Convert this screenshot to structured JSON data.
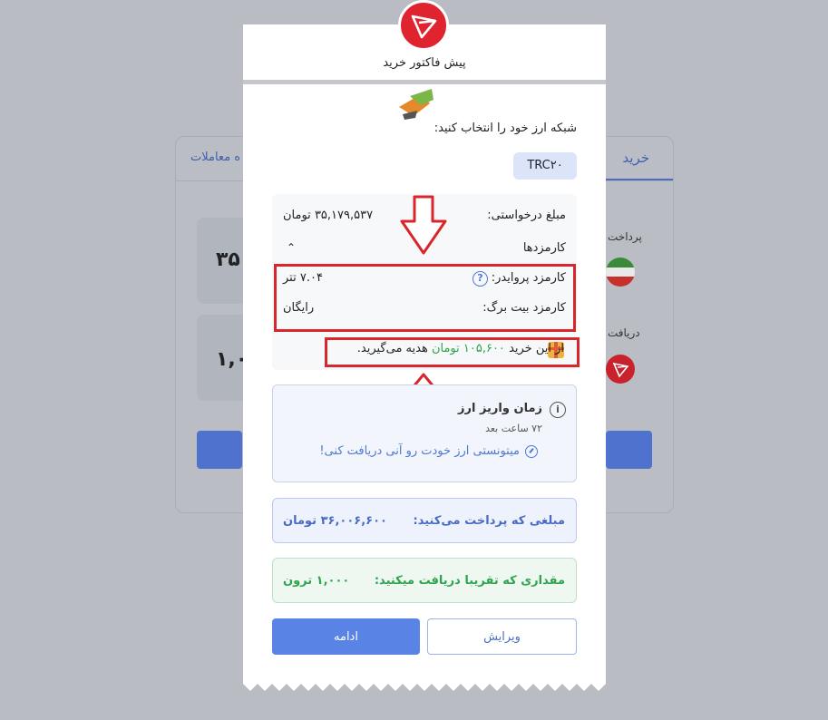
{
  "background": {
    "tab_buy": "خرید",
    "tab_history": "ه معاملات",
    "pay_label": "پرداخت",
    "receive_label": "دریافت",
    "pay_amount_partial": "۳۵",
    "receive_amount_partial": "۱,۰۰"
  },
  "modal": {
    "title": "پیش فاکتور خرید",
    "network_label": "شبکه ارز خود را انتخاب کنید:",
    "network_chip": "TRC۲۰",
    "requested_label": "مبلغ درخواستی:",
    "requested_value": "۳۵,۱۷۹,۵۳۷ تومان",
    "fees_label": "کارمزدها",
    "provider_fee_label": "کارمزد پروایدر:",
    "provider_fee_value": "۷.۰۴ تتر",
    "bitbarg_fee_label": "کارمزد بیت برگ:",
    "bitbarg_fee_value": "رایگان",
    "gift_prefix": "از این خرید",
    "gift_amount": "۱۰۵,۶۰۰ تومان",
    "gift_suffix": "هدیه می‌گیرید.",
    "deposit_time_title": "زمان واریز ارز",
    "deposit_time_value": "۷۲ ساعت بعد",
    "instant_link": "میتونستی ارز خودت رو آنی دریافت کنی!",
    "pay_label": "مبلغی که پرداخت می‌کنید:",
    "pay_value": "۳۶,۰۰۶,۶۰۰ تومان",
    "receive_label": "مقداری که تقریبا دریافت میکنید:",
    "receive_value": "۱,۰۰۰ ترون",
    "continue_button": "ادامه",
    "edit_button": "ویرایش"
  },
  "colors": {
    "accent": "#5a83e6",
    "annotation_red": "#d8262d",
    "tron_red": "#e0242f",
    "gift_green": "#2fa44f"
  }
}
